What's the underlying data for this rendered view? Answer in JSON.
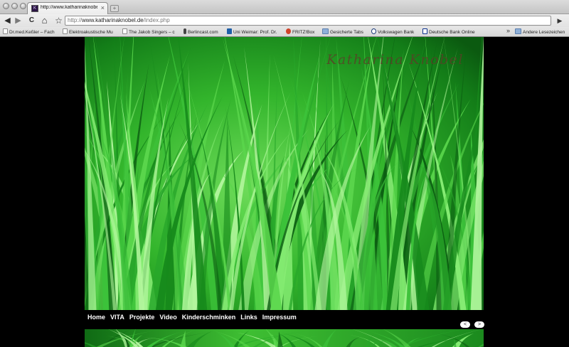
{
  "browser": {
    "tab": {
      "title": "http://www.katharinaknobel.de",
      "close_symbol": "×"
    },
    "toolbar": {
      "back_symbol": "◀",
      "forward_symbol": "▶",
      "reload_symbol": "C",
      "home_symbol": "⌂",
      "star_symbol": "☆",
      "go_symbol": "▶"
    },
    "address_bar": {
      "scheme": "http://",
      "host": "www.katharinaknobel.de",
      "path": "/index.php"
    },
    "bookmarks": [
      {
        "label": "Dr.med.Keßler – Fach",
        "icon": "page-icon"
      },
      {
        "label": "Elektroakustische Mu",
        "icon": "page-icon"
      },
      {
        "label": "The Jakob Singers – c",
        "icon": "page-icon"
      },
      {
        "label": "Berlincast.com",
        "icon": "pin-icon"
      },
      {
        "label": "Uni Weimar: Prof. Dr.",
        "icon": "uni-icon"
      },
      {
        "label": "FRITZ!Box",
        "icon": "fritzbox-icon"
      },
      {
        "label": "Gesicherte Tabs",
        "icon": "folder-icon"
      },
      {
        "label": "Volkswagen Bank",
        "icon": "vw-icon"
      },
      {
        "label": "Deutsche Bank Online",
        "icon": "deutsche-bank-icon"
      }
    ],
    "bookmarks_overflow_symbol": "»",
    "other_bookmarks": {
      "label": "Andere Lesezeichen",
      "icon": "folder-icon"
    }
  },
  "site": {
    "logo_text": "Katharina Knobel",
    "hero_image": "green-grass-photo",
    "nav": [
      "Home",
      "VITA",
      "Projekte",
      "Video",
      "Kinderschminken",
      "Links",
      "Impressum"
    ],
    "slider": {
      "prev_symbol": "<",
      "next_symbol": ">"
    }
  },
  "colors": {
    "page_background": "#000000",
    "nav_text": "#ffffff",
    "grass_dark": "#0a4a10",
    "grass_light": "#7fe870"
  }
}
